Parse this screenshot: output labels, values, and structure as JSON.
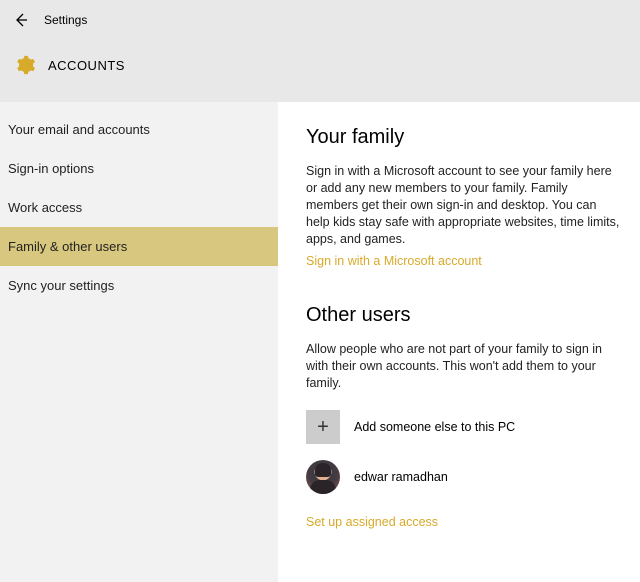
{
  "header": {
    "window_title": "Settings",
    "page_title": "ACCOUNTS"
  },
  "sidebar": {
    "items": [
      {
        "label": "Your email and accounts"
      },
      {
        "label": "Sign-in options"
      },
      {
        "label": "Work access"
      },
      {
        "label": "Family & other users"
      },
      {
        "label": "Sync your settings"
      }
    ],
    "active_index": 3
  },
  "main": {
    "family": {
      "heading": "Your family",
      "desc": "Sign in with a Microsoft account to see your family here or add any new members to your family. Family members get their own sign-in and desktop. You can help kids stay safe with appropriate websites, time limits, apps, and games.",
      "signin_link": "Sign in with a Microsoft account"
    },
    "other": {
      "heading": "Other users",
      "desc": "Allow people who are not part of your family to sign in with their own accounts. This won't add them to your family.",
      "add_label": "Add someone else to this PC",
      "users": [
        {
          "name": "edwar ramadhan"
        }
      ],
      "assigned_link": "Set up assigned access"
    }
  },
  "colors": {
    "accent": "#d8aa2a",
    "sidebar_active": "#d8c77e"
  }
}
